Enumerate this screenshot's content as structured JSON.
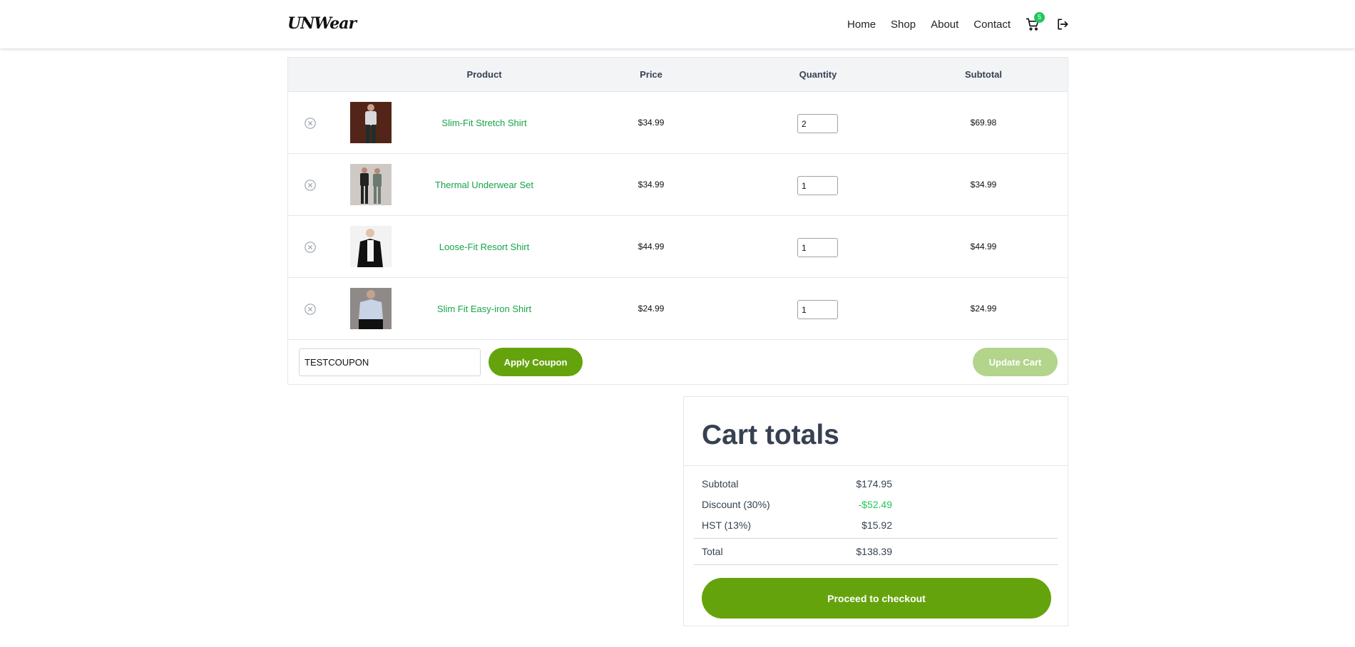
{
  "header": {
    "logo": "UNWear",
    "nav": [
      "Home",
      "Shop",
      "About",
      "Contact"
    ],
    "cart_count": "5"
  },
  "table": {
    "headers": {
      "product": "Product",
      "price": "Price",
      "quantity": "Quantity",
      "subtotal": "Subtotal"
    },
    "rows": [
      {
        "name": "Slim-Fit Stretch Shirt",
        "price": "$34.99",
        "qty": "2",
        "subtotal": "$69.98"
      },
      {
        "name": "Thermal Underwear Set",
        "price": "$34.99",
        "qty": "1",
        "subtotal": "$34.99"
      },
      {
        "name": "Loose-Fit Resort Shirt",
        "price": "$44.99",
        "qty": "1",
        "subtotal": "$44.99"
      },
      {
        "name": "Slim Fit Easy-iron Shirt",
        "price": "$24.99",
        "qty": "1",
        "subtotal": "$24.99"
      }
    ],
    "coupon_value": "TESTCOUPON",
    "apply_label": "Apply Coupon",
    "update_label": "Update Cart"
  },
  "totals": {
    "title": "Cart totals",
    "subtotal_label": "Subtotal",
    "subtotal_value": "$174.95",
    "discount_label": "Discount (30%)",
    "discount_value": "-$52.49",
    "tax_label": "HST (13%)",
    "tax_value": "$15.92",
    "total_label": "Total",
    "total_value": "$138.39",
    "checkout_label": "Proceed to checkout"
  },
  "colors": {
    "accent": "#65a30d",
    "link": "#16a34a",
    "badge": "#22c55e",
    "discount": "#22c55e",
    "disabled_button": "#b2d48b"
  }
}
